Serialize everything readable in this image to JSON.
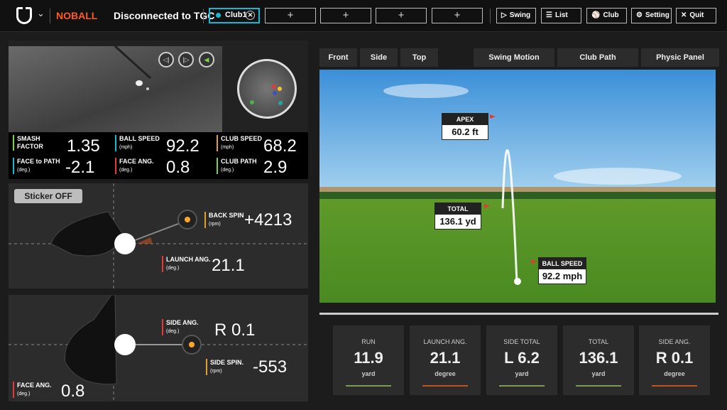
{
  "header": {
    "mode": "NOBALL",
    "connection": "Disconnected to TGC",
    "club_tab": "Club1",
    "add_tab": "+",
    "buttons": {
      "swing": "Swing",
      "list": "List",
      "club": "Club",
      "setting": "Setting",
      "quit": "Quit"
    }
  },
  "stats": {
    "smash_factor": {
      "label": "SMASH FACTOR",
      "value": "1.35"
    },
    "ball_speed": {
      "label": "BALL SPEED",
      "unit": "(mph)",
      "value": "92.2"
    },
    "club_speed": {
      "label": "CLUB SPEED",
      "unit": "(mph)",
      "value": "68.2"
    },
    "face_to_path": {
      "label": "FACE to PATH",
      "unit": "(deg.)",
      "value": "-2.1"
    },
    "face_ang": {
      "label": "FACE ANG.",
      "unit": "(deg.)",
      "value": "0.8"
    },
    "club_path": {
      "label": "CLUB PATH",
      "unit": "(deg.)",
      "value": "2.9"
    }
  },
  "side_view": {
    "sticker_button": "Sticker OFF",
    "back_spin": {
      "label": "BACK SPIN",
      "unit": "(rpm)",
      "value": "+4213"
    },
    "launch_ang": {
      "label": "LAUNCH ANG.",
      "unit": "(deg.)",
      "value": "21.1"
    }
  },
  "top_view": {
    "side_ang": {
      "label": "SIDE ANG.",
      "unit": "(deg.)",
      "value": "R 0.1"
    },
    "side_spin": {
      "label": "SIDE SPIN.",
      "unit": "(rpm)",
      "value": "-553"
    },
    "face_ang": {
      "label": "FACE ANG.",
      "unit": "(deg.)",
      "value": "0.8"
    }
  },
  "view_tabs": [
    "Front",
    "Side",
    "Top"
  ],
  "panel_tabs": [
    "Swing Motion",
    "Club Path",
    "Physic Panel"
  ],
  "callouts": {
    "apex": {
      "label": "APEX",
      "value": "60.2 ft"
    },
    "total": {
      "label": "TOTAL",
      "value": "136.1 yd"
    },
    "ball_speed": {
      "label": "BALL SPEED",
      "value": "92.2 mph"
    }
  },
  "cards": [
    {
      "title": "RUN",
      "value": "11.9",
      "unit": "yard",
      "color": "#7d9a55"
    },
    {
      "title": "LAUNCH ANG.",
      "value": "21.1",
      "unit": "degree",
      "color": "#c0531e"
    },
    {
      "title": "SIDE TOTAL",
      "value": "L 6.2",
      "unit": "yard",
      "color": "#7d9a55"
    },
    {
      "title": "TOTAL",
      "value": "136.1",
      "unit": "yard",
      "color": "#7d9a55"
    },
    {
      "title": "SIDE ANG.",
      "value": "R 0.1",
      "unit": "degree",
      "color": "#c0531e"
    }
  ],
  "colors": {
    "accent_orange": "#ff5a1f",
    "accent_cyan": "#19b7d6",
    "panel": "#2c2c2c"
  }
}
